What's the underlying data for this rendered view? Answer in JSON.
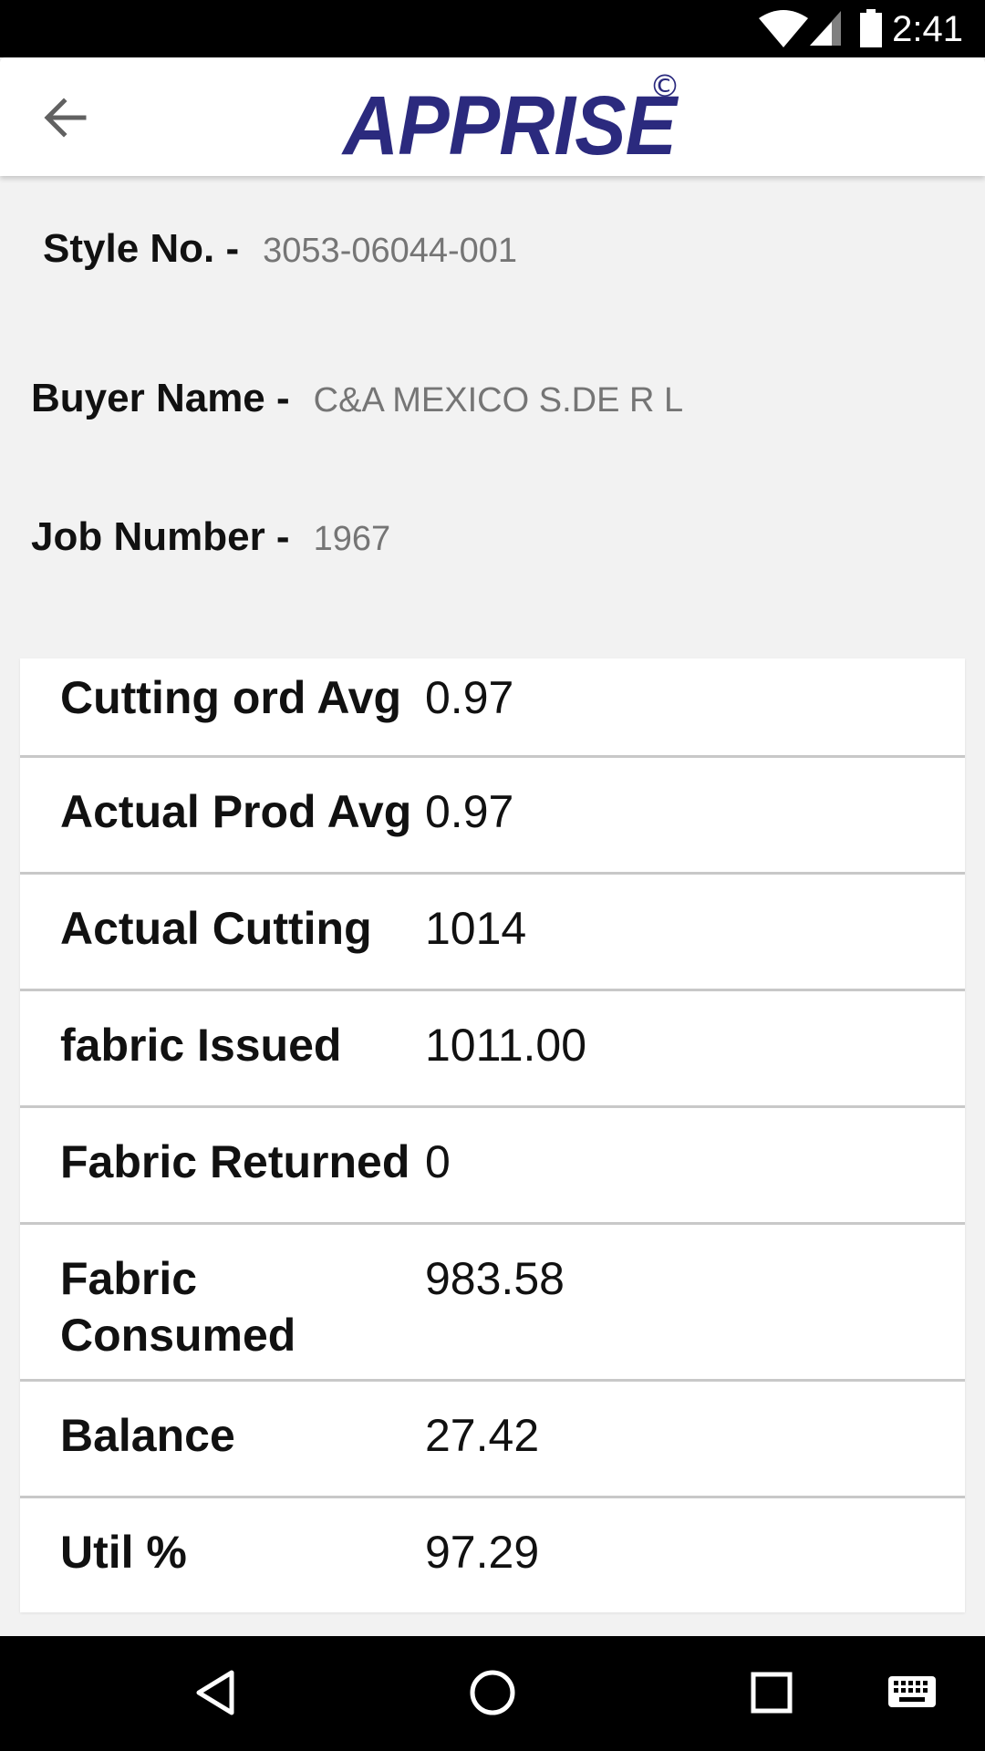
{
  "status_bar": {
    "time": "2:41",
    "icons": [
      "wifi-icon",
      "cell-signal-icon",
      "battery-icon"
    ]
  },
  "app_bar": {
    "logo_text": "APPRISE",
    "logo_mark": "©",
    "brand_color": "#2b2a7e",
    "back_icon": "arrow-left-icon"
  },
  "info": {
    "style_label": "Style No. -",
    "style_value": "3053-06044-001",
    "buyer_label": "Buyer Name -",
    "buyer_value": "C&A MEXICO S.DE R L",
    "job_label": "Job Number -",
    "job_value": "1967"
  },
  "table": {
    "rows": [
      {
        "label": "Cutting ord Avg",
        "value": "0.97"
      },
      {
        "label": "Actual Prod Avg",
        "value": "0.97"
      },
      {
        "label": "Actual Cutting",
        "value": "1014"
      },
      {
        "label": "fabric Issued",
        "value": "1011.00"
      },
      {
        "label": "Fabric Returned",
        "value": "0"
      },
      {
        "label": "Fabric Consumed",
        "value": "983.58"
      },
      {
        "label": "Balance",
        "value": "27.42"
      },
      {
        "label": "Util %",
        "value": "97.29"
      }
    ]
  },
  "nav_bar": {
    "icons": [
      "back-triangle-icon",
      "home-circle-icon",
      "recents-square-icon",
      "keyboard-icon"
    ]
  }
}
